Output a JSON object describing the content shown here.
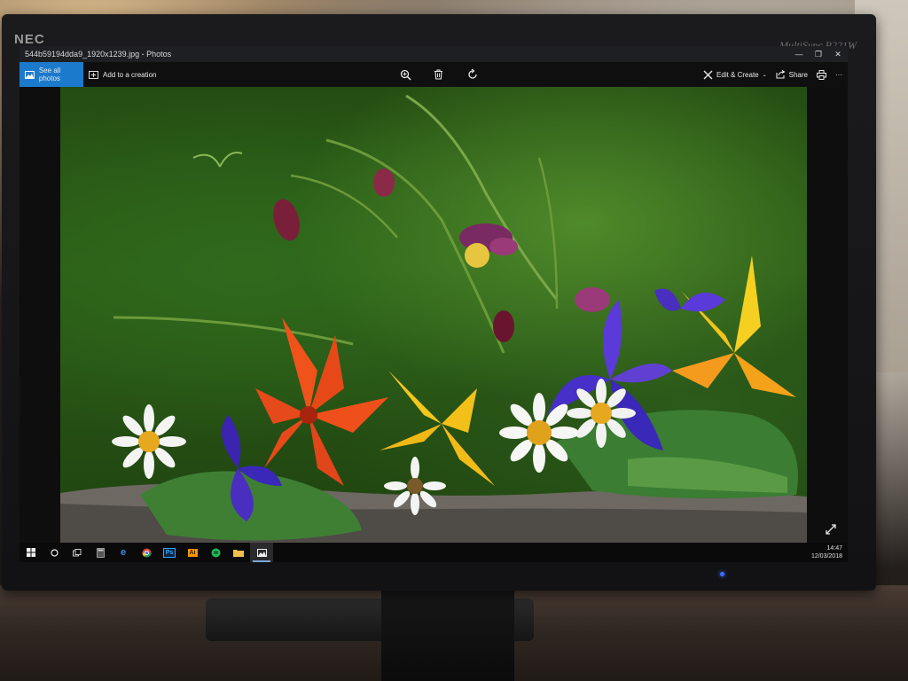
{
  "monitor": {
    "brand": "NEC",
    "model": "MultiSync P221W"
  },
  "window": {
    "title": "544b59194dda9_1920x1239.jpg - Photos",
    "minimize": "—",
    "maximize": "❐",
    "close": "✕"
  },
  "toolbar": {
    "see_all_label": "See all photos",
    "add_creation_label": "Add to a creation",
    "edit_create_label": "Edit & Create",
    "share_label": "Share",
    "more_label": "···"
  },
  "taskbar": {
    "apps": [
      "windows-start-icon",
      "cortana-icon",
      "task-view-icon",
      "calculator-icon",
      "edge-icon",
      "chrome-icon",
      "photoshop-icon",
      "illustrator-icon",
      "spotify-icon",
      "file-explorer-icon",
      "photos-icon"
    ],
    "photoshop_label": "Ps",
    "illustrator_label": "Ai",
    "time": "14:47",
    "date": "12/03/2018"
  },
  "colors": {
    "accent": "#1c7acc",
    "titlebar": "#1d1f22",
    "led": "#3c6cff"
  }
}
